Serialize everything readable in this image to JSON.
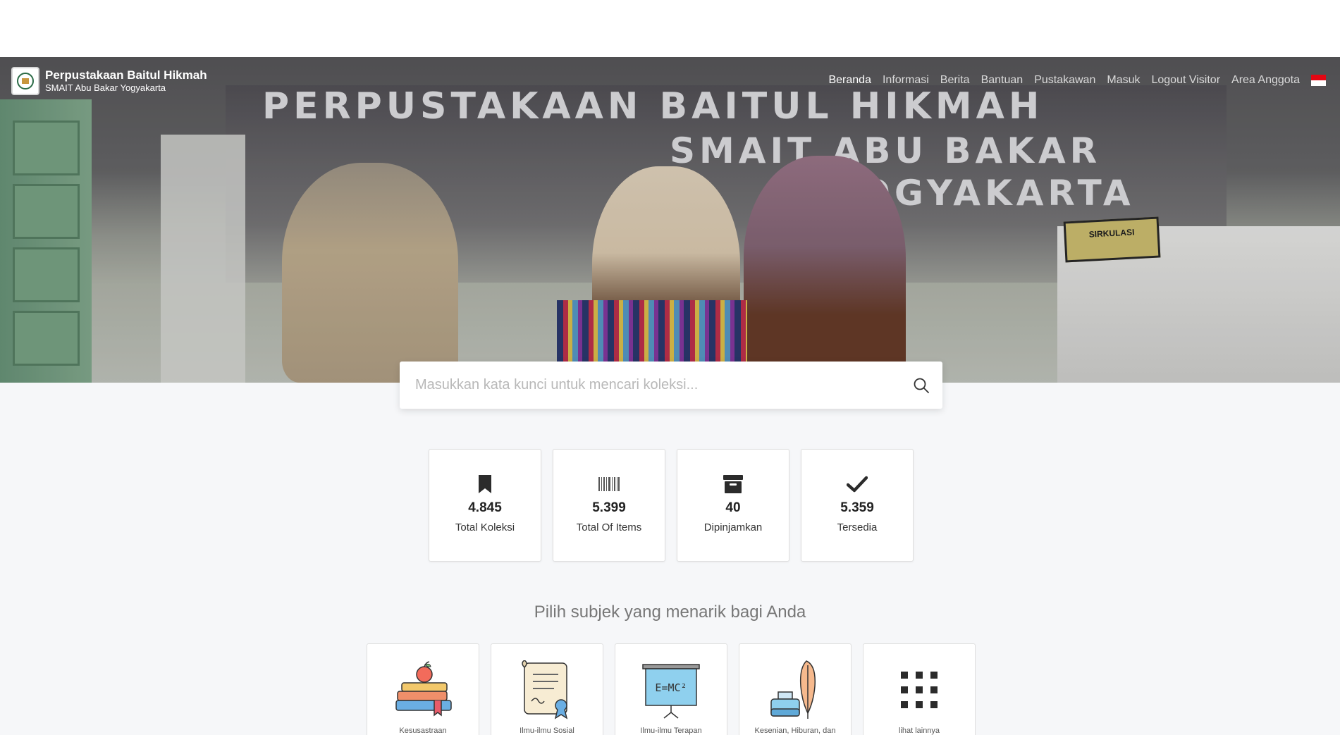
{
  "brand": {
    "title": "Perpustakaan Baitul Hikmah",
    "subtitle": "SMAIT Abu Bakar Yogyakarta"
  },
  "nav": {
    "items": [
      {
        "label": "Beranda",
        "active": true
      },
      {
        "label": "Informasi"
      },
      {
        "label": "Berita"
      },
      {
        "label": "Bantuan"
      },
      {
        "label": "Pustakawan"
      },
      {
        "label": "Masuk"
      },
      {
        "label": "Logout Visitor"
      },
      {
        "label": "Area Anggota"
      }
    ],
    "language_flag": "indonesia-flag-icon"
  },
  "hero": {
    "sign_line1": "PERPUSTAKAAN BAITUL HIKMAH",
    "sign_line2": "SMAIT ABU BAKAR",
    "sign_line3": "YOGYAKARTA",
    "desk_sign": "SIRKULASI"
  },
  "search": {
    "placeholder": "Masukkan kata kunci untuk mencari koleksi...",
    "icon": "search-icon"
  },
  "stats": [
    {
      "icon": "bookmark-icon",
      "value": "4.845",
      "label": "Total Koleksi"
    },
    {
      "icon": "barcode-icon",
      "value": "5.399",
      "label": "Total Of Items"
    },
    {
      "icon": "archive-icon",
      "value": "40",
      "label": "Dipinjamkan"
    },
    {
      "icon": "check-icon",
      "value": "5.359",
      "label": "Tersedia"
    }
  ],
  "subjects_heading": "Pilih subjek yang menarik bagi Anda",
  "subjects": [
    {
      "icon": "books-apple-icon",
      "label": "Kesusastraan"
    },
    {
      "icon": "scroll-certificate-icon",
      "label": "Ilmu-ilmu Sosial"
    },
    {
      "icon": "blackboard-formula-icon",
      "label": "Ilmu-ilmu Terapan"
    },
    {
      "icon": "ink-feather-icon",
      "label": "Kesenian, Hiburan, dan"
    },
    {
      "icon": "grid-icon",
      "label": "lihat lainnya"
    }
  ],
  "colors": {
    "flag_red": "#e30613",
    "flag_white": "#ffffff",
    "page_bg": "#f6f7f9",
    "icon_dark": "#2b2b2b"
  }
}
